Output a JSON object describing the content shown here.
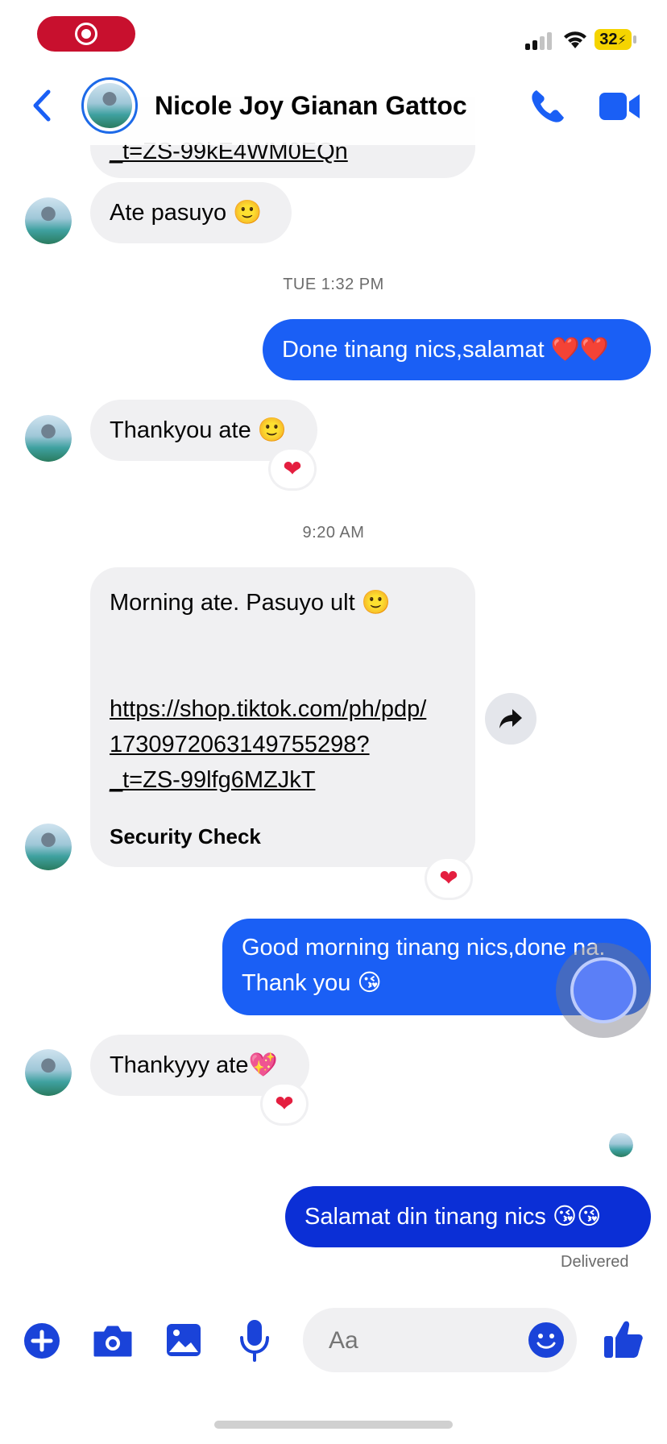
{
  "status_bar": {
    "battery": "32"
  },
  "header": {
    "contact_name": "Nicole Joy Gianan Gattoc"
  },
  "messages": {
    "prev_link_tail": "_t=ZS-99kE4WM0EQn",
    "m1": "Ate pasuyo 🙂",
    "ts1": "TUE 1:32 PM",
    "m2": "Done tinang nics,salamat ❤️❤️",
    "m3": "Thankyou ate 🙂",
    "m3_reaction": "❤",
    "ts2": "9:20 AM",
    "m4_line1": "Morning ate. Pasuyo ult 🙂",
    "m4_link": [
      "https://shop.tiktok.com/ph/pdp/",
      "1730972063149755298?",
      "_t=ZS-99lfg6MZJkT"
    ],
    "m4_preview_title": "Security Check",
    "m4_reaction": "❤",
    "m5_line1": "Good morning tinang nics,done na.",
    "m5_line2": "Thank you 😘",
    "m6": "Thankyyy ate💖",
    "m6_reaction": "❤",
    "m7": "Salamat din tinang nics 😘😘",
    "delivered": "Delivered"
  },
  "composer": {
    "placeholder": "Aa"
  },
  "colors": {
    "accent": "#1a5ff5",
    "outgoing_dark": "#0b2fd6",
    "incoming": "#f0f0f2",
    "recording": "#c8102e"
  },
  "icons": [
    "back-chevron-icon",
    "phone-icon",
    "video-camera-icon",
    "share-forward-icon",
    "plus-icon",
    "camera-icon",
    "photo-icon",
    "microphone-icon",
    "smiley-icon",
    "thumbs-up-icon"
  ]
}
